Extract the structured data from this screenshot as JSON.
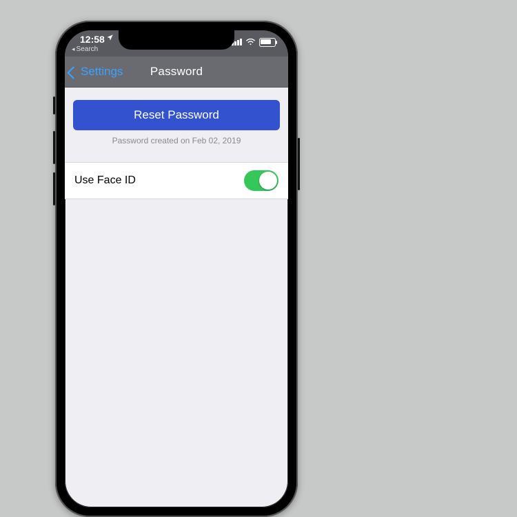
{
  "status": {
    "time": "12:58",
    "back_app": "Search"
  },
  "nav": {
    "back_label": "Settings",
    "title": "Password"
  },
  "main": {
    "reset_label": "Reset Password",
    "created_label": "Password created on Feb 02, 2019",
    "faceid_label": "Use Face ID",
    "faceid_on": true
  },
  "colors": {
    "accent_button": "#3352cf",
    "switch_on": "#34c759",
    "back_link": "#3aa3ff"
  }
}
